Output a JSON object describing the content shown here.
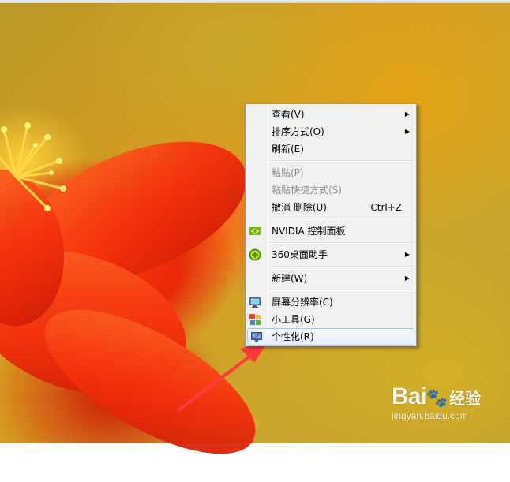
{
  "menu": {
    "items": [
      {
        "label": "查看(V)",
        "submenu": "▶"
      },
      {
        "label": "排序方式(O)",
        "submenu": "▶"
      },
      {
        "label": "刷新(E)"
      },
      {
        "label": "粘贴(P)"
      },
      {
        "label": "粘贴快捷方式(S)"
      },
      {
        "label": "撤消 删除(U)",
        "shortcut": "Ctrl+Z"
      },
      {
        "label": "NVIDIA 控制面板",
        "icon": "nvidia-icon"
      },
      {
        "label": "360桌面助手",
        "icon": "360-icon",
        "submenu": "▶"
      },
      {
        "label": "新建(W)",
        "submenu": "▶"
      },
      {
        "label": "屏幕分辨率(C)",
        "icon": "monitor-icon"
      },
      {
        "label": "小工具(G)",
        "icon": "gadgets-icon"
      },
      {
        "label": "个性化(R)",
        "icon": "personalize-icon",
        "state": "hover"
      }
    ]
  },
  "watermark": {
    "logo": "Bai",
    "logo_suffix": "经验",
    "url": "jingyan.baidu.com"
  },
  "colors": {
    "menu_background": "#f0f0f0",
    "hover_border": "#a8c8eb",
    "disabled_text": "#8d8d8d",
    "annotation_arrow": "#ff3b3b"
  }
}
